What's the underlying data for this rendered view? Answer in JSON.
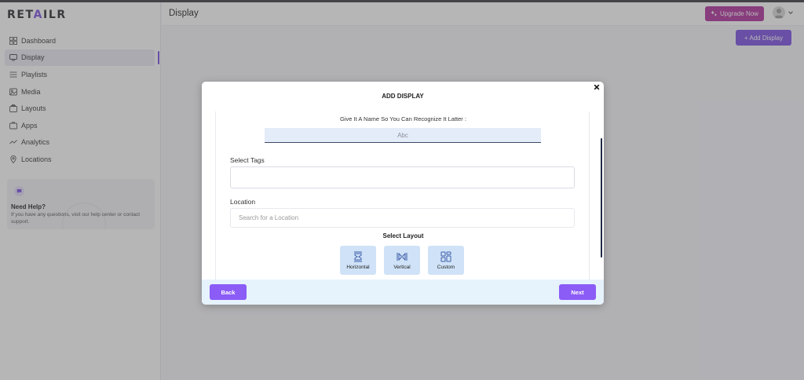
{
  "app": {
    "logo_prefix": "RET",
    "logo_accent": "A",
    "logo_suffix": "ILR"
  },
  "sidebar": {
    "items": [
      {
        "label": "Dashboard",
        "icon": "dashboard-icon"
      },
      {
        "label": "Display",
        "icon": "display-icon",
        "active": true
      },
      {
        "label": "Playlists",
        "icon": "playlist-icon"
      },
      {
        "label": "Media",
        "icon": "media-icon"
      },
      {
        "label": "Layouts",
        "icon": "layouts-icon"
      },
      {
        "label": "Apps",
        "icon": "apps-icon"
      },
      {
        "label": "Analytics",
        "icon": "analytics-icon"
      },
      {
        "label": "Locations",
        "icon": "location-icon"
      }
    ],
    "help": {
      "title": "Need Help?",
      "text": "If you have any questions, visit our help center or contact support."
    }
  },
  "header": {
    "title": "Display",
    "upgrade_label": "Upgrade Now",
    "add_display_label": "+ Add Display"
  },
  "modal": {
    "title": "ADD DISPLAY",
    "name_prompt": "Give It A Name So You Can Recognize It Latter :",
    "name_placeholder": "Abc",
    "tags_label": "Select Tags",
    "location_label": "Location",
    "location_placeholder": "Search for a Location",
    "layout_label": "Select Layout",
    "layouts": [
      {
        "label": "Horizontal",
        "icon": "horizontal-layout-icon"
      },
      {
        "label": "Vertical",
        "icon": "vertical-layout-icon"
      },
      {
        "label": "Custom",
        "icon": "custom-layout-icon"
      }
    ],
    "back_label": "Back",
    "next_label": "Next"
  },
  "colors": {
    "accent": "#7b4fe0",
    "upgrade": "#b0309a",
    "button": "#8b5cf6",
    "footer": "#e6f2fc",
    "layout_tile": "#cfe2f7"
  }
}
